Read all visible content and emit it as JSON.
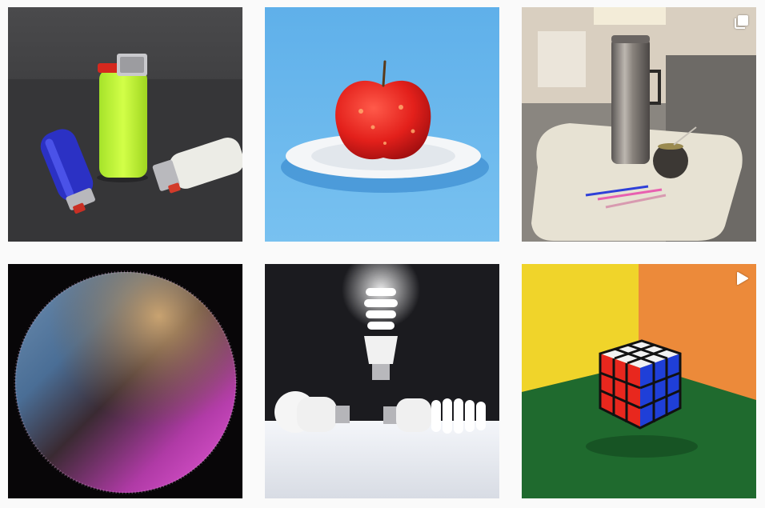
{
  "grid": {
    "posts": [
      {
        "subject": "lighters",
        "badge": "none"
      },
      {
        "subject": "apple-on-plate",
        "badge": "none"
      },
      {
        "subject": "thermos-on-table",
        "badge": "carousel-icon"
      },
      {
        "subject": "fur-sphere",
        "badge": "none"
      },
      {
        "subject": "cfl-bulbs",
        "badge": "none"
      },
      {
        "subject": "rubiks-cube",
        "badge": "video-icon"
      }
    ]
  },
  "colors": {
    "background": "#fafafa",
    "badge": "#ffffff"
  }
}
